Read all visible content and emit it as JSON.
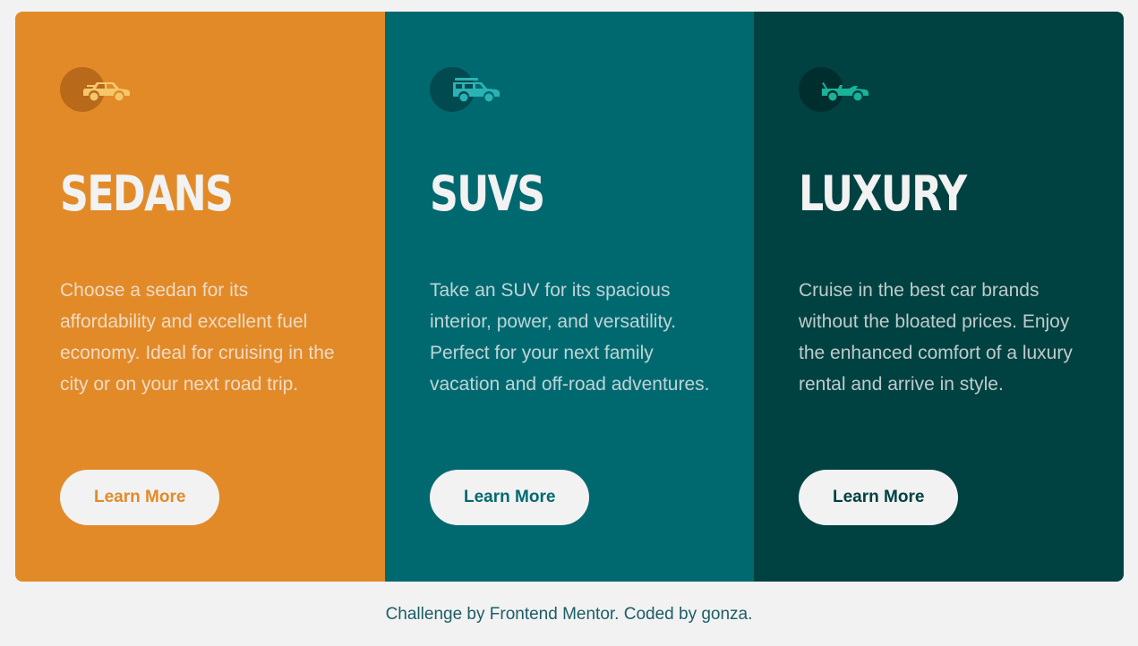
{
  "colors": {
    "page_bg": "#f2f2f2",
    "sedans": "#e28a28",
    "suvs": "#006970",
    "luxury": "#004141",
    "light": "#f2f2f2"
  },
  "cards": [
    {
      "title": "SEDANS",
      "description": "Choose a sedan for its affordability and excellent fuel economy. Ideal for cruising in the city or on your next road trip.",
      "button_label": "Learn More",
      "icon": "sedan-car-icon",
      "icon_color": "#f5c76b",
      "button_text_color": "#e28a28"
    },
    {
      "title": "SUVS",
      "description": "Take an SUV for its spacious interior, power, and versatility. Perfect for your next family vacation and off-road adventures.",
      "button_label": "Learn More",
      "icon": "suv-car-icon",
      "icon_color": "#2bb3b4",
      "button_text_color": "#006970"
    },
    {
      "title": "LUXURY",
      "description": "Cruise in the best car brands without the bloated prices. Enjoy the enhanced comfort of a luxury rental and arrive in style.",
      "button_label": "Learn More",
      "icon": "convertible-car-icon",
      "icon_color": "#19b39a",
      "button_text_color": "#004141"
    }
  ],
  "footer": {
    "text": "Challenge by Frontend Mentor. Coded by gonza."
  }
}
